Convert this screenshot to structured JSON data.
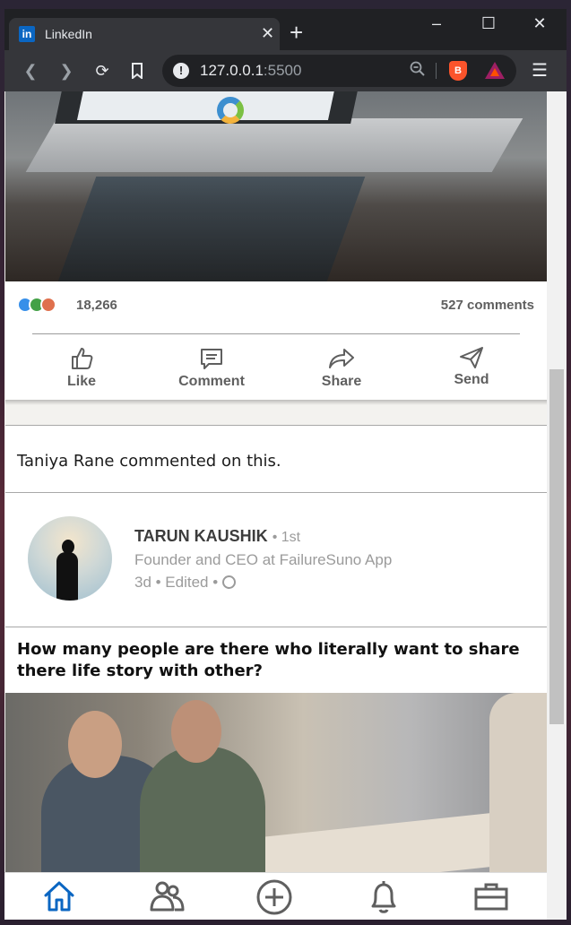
{
  "browser": {
    "tab_title": "LinkedIn",
    "tab_favicon_text": "in",
    "url_host": "127.0.0.1",
    "url_port": ":5500",
    "info_glyph": "!",
    "brave_glyph": "B",
    "icons": [
      "back-icon",
      "forward-icon",
      "reload-icon",
      "bookmark-icon",
      "zoom-icon",
      "brave-shield-icon",
      "bat-rewards-icon",
      "menu-icon"
    ]
  },
  "window_controls": {
    "minimize": "–",
    "maximize": "☐",
    "close": "✕"
  },
  "post_stats": {
    "reactions_count": "18,266",
    "comments_count": "527 comments",
    "reaction_types": [
      "like",
      "celebrate",
      "love"
    ]
  },
  "actions": [
    {
      "label": "Like",
      "icon": "thumbs-up-icon"
    },
    {
      "label": "Comment",
      "icon": "comment-icon"
    },
    {
      "label": "Share",
      "icon": "share-icon"
    },
    {
      "label": "Send",
      "icon": "send-icon"
    }
  ],
  "activity": {
    "text": "Taniya Rane commented on this."
  },
  "author": {
    "name": "TARUN KAUSHIK",
    "degree": "• 1st",
    "headline": "Founder and CEO at FailureSuno App",
    "meta": "3d • Edited • "
  },
  "post": {
    "text": "How many people are there who literally want to share there life story with other?"
  },
  "bottom_nav": [
    {
      "name": "home",
      "icon": "home-icon",
      "active": true
    },
    {
      "name": "my-network",
      "icon": "network-icon",
      "active": false
    },
    {
      "name": "post",
      "icon": "add-post-icon",
      "active": false
    },
    {
      "name": "notifications",
      "icon": "bell-icon",
      "active": false
    },
    {
      "name": "jobs",
      "icon": "briefcase-icon",
      "active": false
    }
  ],
  "colors": {
    "accent": "#0a66c2",
    "muted": "#5f5f5f",
    "secondary": "#9b9b9b"
  }
}
